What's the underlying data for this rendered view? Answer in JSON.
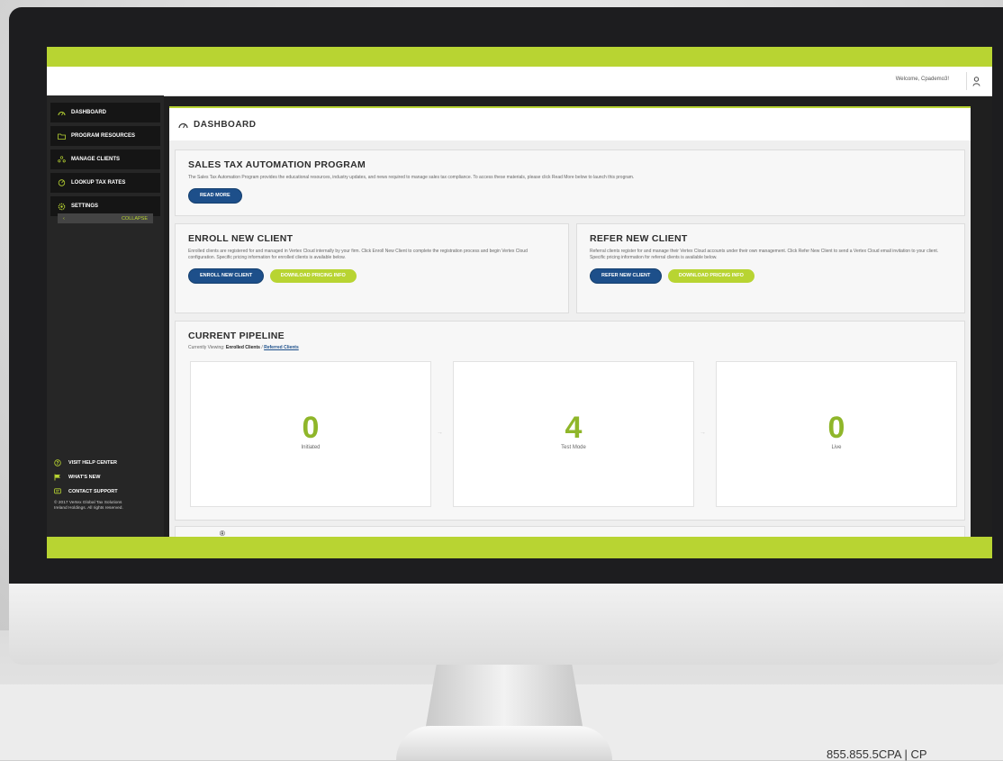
{
  "header": {
    "welcome": "Welcome, Cpademo3!"
  },
  "sidebar": {
    "items": [
      {
        "label": "DASHBOARD",
        "icon": "dashboard-icon"
      },
      {
        "label": "PROGRAM RESOURCES",
        "icon": "folder-icon"
      },
      {
        "label": "MANAGE CLIENTS",
        "icon": "clients-icon"
      },
      {
        "label": "LOOKUP TAX RATES",
        "icon": "gauge-icon"
      },
      {
        "label": "SETTINGS",
        "icon": "gear-icon"
      }
    ],
    "collapse_arrow": "‹",
    "collapse_label": "COLLAPSE",
    "footer": [
      {
        "label": "VISIT HELP CENTER",
        "icon": "help-icon"
      },
      {
        "label": "WHAT'S NEW",
        "icon": "flag-icon"
      },
      {
        "label": "CONTACT SUPPORT",
        "icon": "chat-icon"
      }
    ],
    "copyright_1": "© 2017 Vertex Global Tax Solutions",
    "copyright_2": "Ireland Holdings. All rights reserved."
  },
  "page": {
    "title": "DASHBOARD"
  },
  "sales_tax": {
    "title": "SALES TAX AUTOMATION PROGRAM",
    "text": "The Sales Tax Automation Program provides the educational resources, industry updates, and news required to manage sales tax compliance. To access these materials, please click Read More below to launch this program.",
    "button": "READ MORE"
  },
  "enroll": {
    "title": "ENROLL NEW CLIENT",
    "text": "Enrolled clients are registered for and managed in Vertex Cloud internally by your firm. Click Enroll New Client to complete the registration process and begin Vertex Cloud configuration. Specific pricing information for enrolled clients is available below.",
    "primary_button": "ENROLL NEW CLIENT",
    "secondary_button": "DOWNLOAD PRICING INFO"
  },
  "refer": {
    "title": "REFER NEW CLIENT",
    "text": "Referral clients register for and manage their Vertex Cloud accounts under their own management. Click Refer New Client to send a Vertex Cloud email invitation to your client. Specific pricing information for referral clients is available below.",
    "primary_button": "REFER NEW CLIENT",
    "secondary_button": "DOWNLOAD PRICING INFO"
  },
  "pipeline": {
    "title": "CURRENT PIPELINE",
    "viewing_prefix": "Currently Viewing:",
    "viewing_current": "Enrolled Clients",
    "separator": "/",
    "viewing_link": "Referred Clients",
    "arrow": "→",
    "stages": [
      {
        "value": "0",
        "label": "Initiated"
      },
      {
        "value": "4",
        "label": "Test Mode"
      },
      {
        "value": "0",
        "label": "Live"
      }
    ]
  },
  "misc": {
    "registered": "®",
    "phone": "855.855.5CPA  |  CP"
  },
  "colors": {
    "accent_green": "#b8d432",
    "primary_blue": "#1d4f8a",
    "sidebar_bg": "#262626"
  }
}
